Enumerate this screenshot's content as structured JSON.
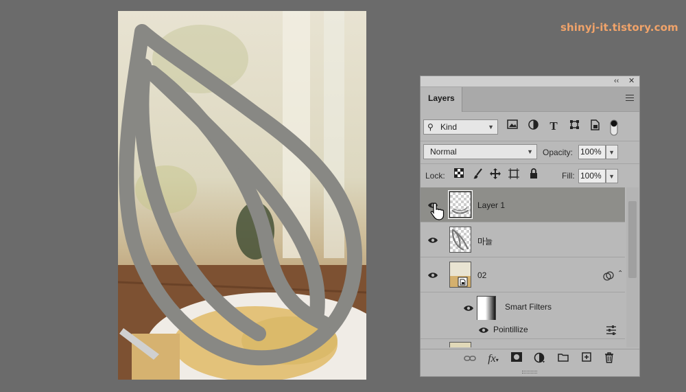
{
  "watermark": "shinyj-it.tistory.com",
  "panel": {
    "collapse_glyph": "‹‹",
    "close_glyph": "✕",
    "tab_label": "Layers",
    "filter": {
      "kind_label": "Kind",
      "icons": [
        "image-filter-icon",
        "adjustment-filter-icon",
        "type-filter-icon",
        "shape-filter-icon",
        "smart-object-filter-icon",
        "filter-toggle-icon"
      ]
    },
    "blend_mode": "Normal",
    "opacity_label": "Opacity:",
    "opacity_value": "100%",
    "lock_label": "Lock:",
    "fill_label": "Fill:",
    "fill_value": "100%",
    "layers": [
      {
        "name": "Layer 1",
        "selected": true
      },
      {
        "name": "마늘",
        "selected": false
      },
      {
        "name": "02",
        "selected": false
      },
      {
        "name": "Smart Filters",
        "selected": false
      },
      {
        "name": "Pointillize",
        "selected": false
      }
    ],
    "bottom_icons": [
      "link-icon",
      "fx-icon",
      "mask-icon",
      "adjustment-icon",
      "folder-icon",
      "new-layer-icon",
      "trash-icon"
    ]
  },
  "colors": {
    "background": "#6b6b6b",
    "panel": "#b9b9b9",
    "selected_layer": "#8e8e8a",
    "stroke": "#888884",
    "watermark": "#f0a36a"
  }
}
